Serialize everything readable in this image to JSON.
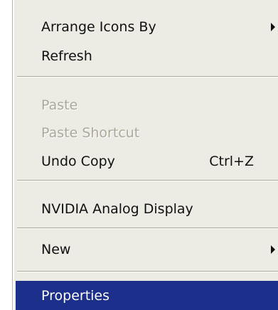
{
  "context_menu": {
    "items": [
      {
        "label": "Arrange Icons By",
        "has_submenu": true
      },
      {
        "label": "Refresh"
      },
      {
        "label": "Paste",
        "disabled": true
      },
      {
        "label": "Paste Shortcut",
        "disabled": true
      },
      {
        "label": "Undo Copy",
        "shortcut": "Ctrl+Z"
      },
      {
        "label": "NVIDIA Analog Display"
      },
      {
        "label": "New",
        "has_submenu": true
      },
      {
        "label": "Properties",
        "selected": true
      }
    ]
  },
  "colors": {
    "menu_background": "#ecebe4",
    "selection_background": "#1c2f8a",
    "disabled_text": "#aca899",
    "text": "#111111"
  }
}
